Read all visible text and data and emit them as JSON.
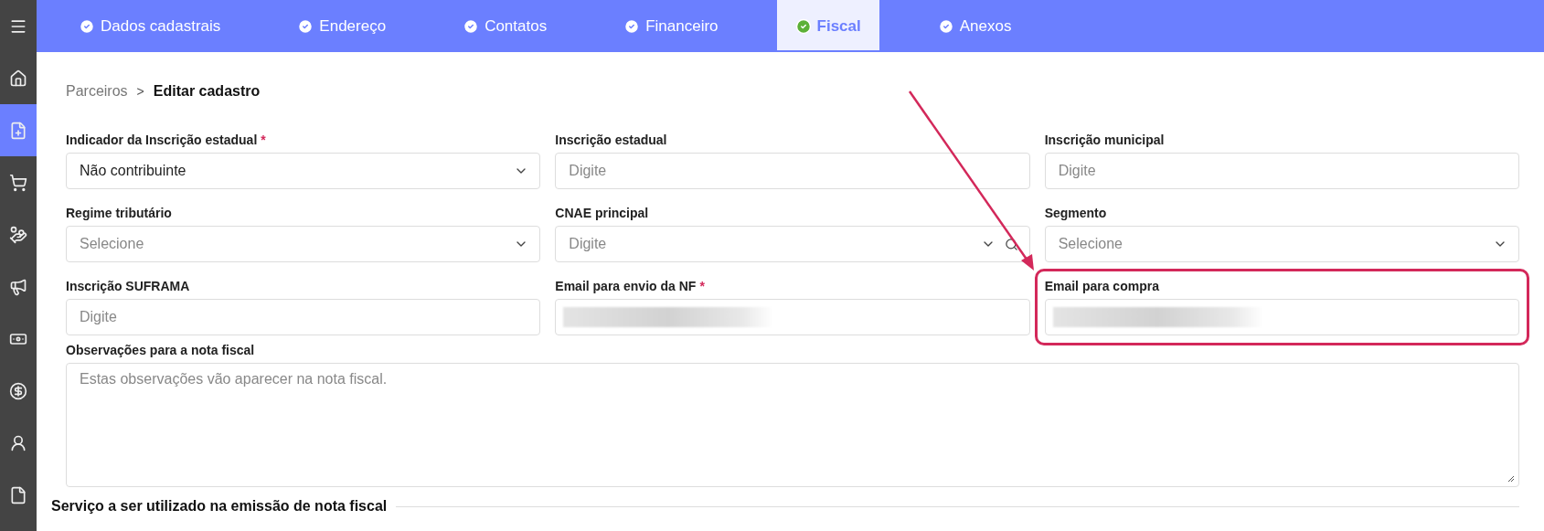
{
  "sidebar": {
    "items": [
      {
        "selected": false
      },
      {
        "selected": false
      },
      {
        "selected": true
      },
      {
        "selected": false
      },
      {
        "selected": false
      },
      {
        "selected": false
      },
      {
        "selected": false
      },
      {
        "selected": false
      },
      {
        "selected": false
      },
      {
        "selected": false
      }
    ]
  },
  "tabs": [
    {
      "label": "Dados cadastrais",
      "selected": false
    },
    {
      "label": "Endereço",
      "selected": false
    },
    {
      "label": "Contatos",
      "selected": false
    },
    {
      "label": "Financeiro",
      "selected": false
    },
    {
      "label": "Fiscal",
      "selected": true
    },
    {
      "label": "Anexos",
      "selected": false
    }
  ],
  "breadcrumb": {
    "parent": "Parceiros",
    "separator": ">",
    "current": "Editar cadastro"
  },
  "fields": [
    {
      "kind": "select",
      "label": "Indicador da Inscrição estadual",
      "required_mark": "*",
      "value": "Não contribuinte",
      "highlighted": false
    },
    {
      "kind": "text",
      "label": "Inscrição estadual",
      "placeholder": "Digite",
      "highlighted": false
    },
    {
      "kind": "text",
      "label": "Inscrição municipal",
      "placeholder": "Digite",
      "highlighted": false
    },
    {
      "kind": "select",
      "label": "Regime tributário",
      "placeholder": "Selecione",
      "highlighted": false
    },
    {
      "kind": "search-select",
      "label": "CNAE principal",
      "placeholder": "Digite",
      "highlighted": false
    },
    {
      "kind": "select",
      "label": "Segmento",
      "placeholder": "Selecione",
      "highlighted": false
    },
    {
      "kind": "text",
      "label": "Inscrição SUFRAMA",
      "placeholder": "Digite",
      "highlighted": false
    },
    {
      "kind": "redacted",
      "label": "Email para envio da NF",
      "required_mark": "*",
      "highlighted": false
    },
    {
      "kind": "redacted",
      "label": "Email para compra",
      "highlighted": true
    }
  ],
  "notes": {
    "label": "Observações para a nota fiscal",
    "placeholder": "Estas observações vão aparecer na nota fiscal."
  },
  "section_title": "Serviço a ser utilizado na emissão de nota fiscal"
}
